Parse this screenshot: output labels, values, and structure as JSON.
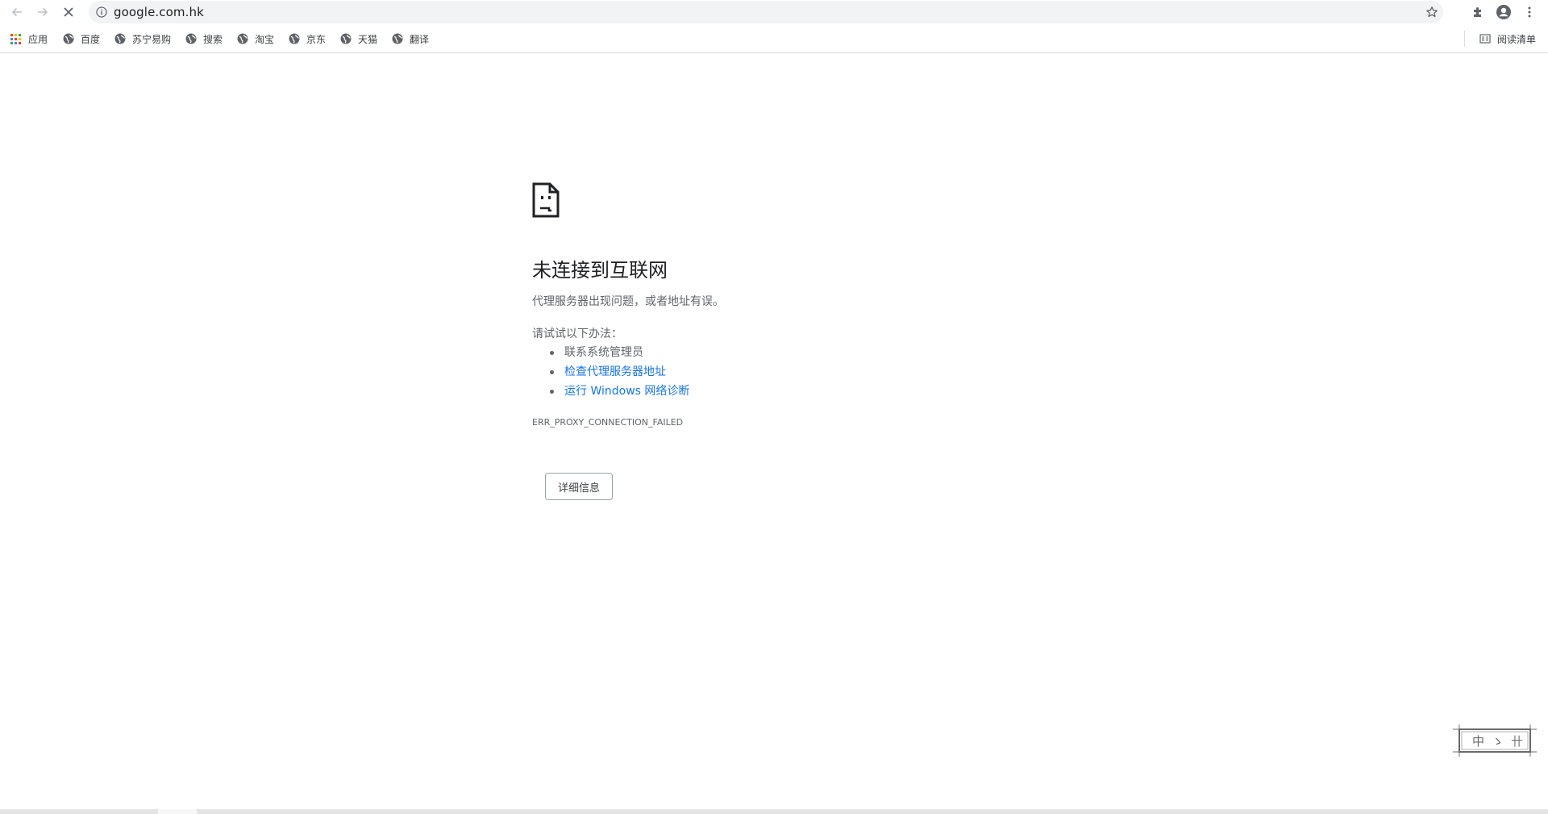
{
  "browser": {
    "url": "google.com.hk",
    "bookmarks": [
      {
        "label": "应用",
        "icon": "apps-grid-icon"
      },
      {
        "label": "百度",
        "icon": "globe-icon"
      },
      {
        "label": "苏宁易购",
        "icon": "globe-icon"
      },
      {
        "label": "搜索",
        "icon": "globe-icon"
      },
      {
        "label": "淘宝",
        "icon": "globe-icon"
      },
      {
        "label": "京东",
        "icon": "globe-icon"
      },
      {
        "label": "天猫",
        "icon": "globe-icon"
      },
      {
        "label": "翻译",
        "icon": "globe-icon"
      }
    ],
    "reading_list": "阅读清单"
  },
  "error_page": {
    "title": "未连接到互联网",
    "description": "代理服务器出现问题，或者地址有误。",
    "try_label": "请试试以下办法：",
    "suggestions": [
      {
        "text": "联系系统管理员",
        "is_link": false
      },
      {
        "text": "检查代理服务器地址",
        "is_link": true
      },
      {
        "text": "运行 Windows 网络诊断",
        "is_link": true
      }
    ],
    "error_code": "ERR_PROXY_CONNECTION_FAILED",
    "details_button": "详细信息"
  },
  "ime_stamp": {
    "chars": [
      "中",
      "ゝ",
      "卄"
    ]
  },
  "colors": {
    "link": "#1a73e8",
    "text_secondary": "#5f6368",
    "omnibox_bg": "#f1f3f4",
    "apps_grid": [
      "#ea4335",
      "#fbbc04",
      "#34a853",
      "#4285f4"
    ]
  }
}
